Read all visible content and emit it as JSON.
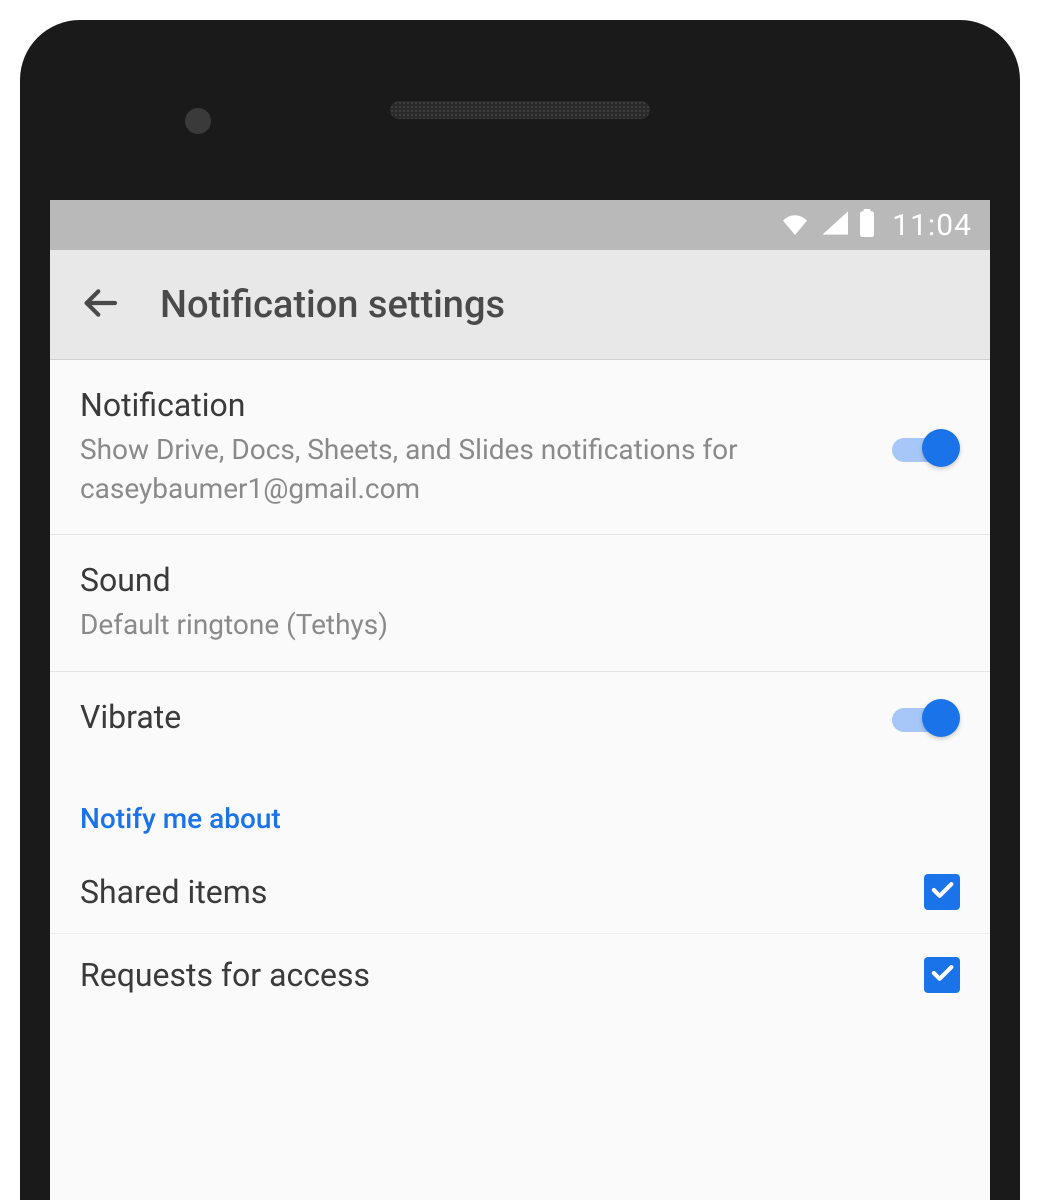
{
  "status_bar": {
    "time": "11:04"
  },
  "app_bar": {
    "title": "Notification settings"
  },
  "settings": {
    "notification": {
      "title": "Notification",
      "subtitle": "Show Drive, Docs, Sheets, and Slides notifications for caseybaumer1@gmail.com",
      "enabled": true
    },
    "sound": {
      "title": "Sound",
      "subtitle": "Default ringtone (Tethys)"
    },
    "vibrate": {
      "title": "Vibrate",
      "enabled": true
    }
  },
  "section_header": "Notify me about",
  "notify_items": {
    "shared": {
      "label": "Shared items",
      "checked": true
    },
    "requests": {
      "label": "Requests for access",
      "checked": true
    }
  },
  "colors": {
    "accent": "#1a73e8"
  }
}
